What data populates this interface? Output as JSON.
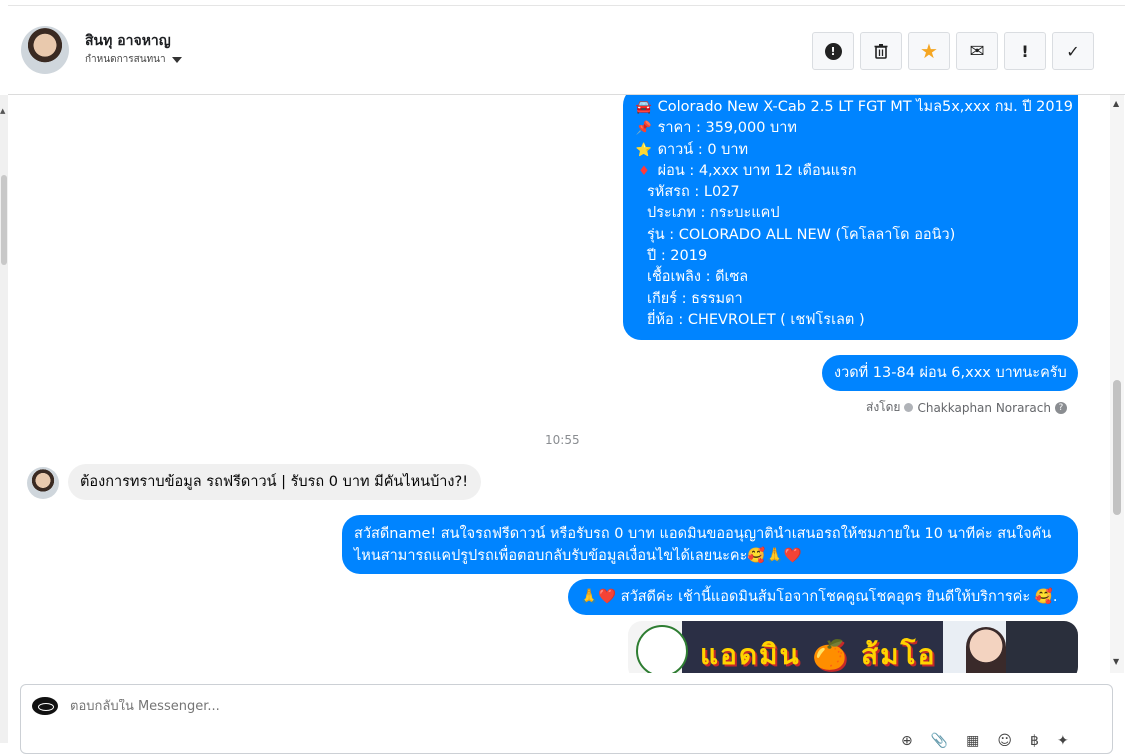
{
  "header": {
    "contact_name": "สินทุ อาจหาญ",
    "subtitle": "กำหนดการสนทนา",
    "actions": [
      {
        "name": "report",
        "glyph": "!"
      },
      {
        "name": "delete",
        "glyph": "🗑"
      },
      {
        "name": "star",
        "glyph": "★"
      },
      {
        "name": "mail",
        "glyph": "✉"
      },
      {
        "name": "important",
        "glyph": "!"
      },
      {
        "name": "done",
        "glyph": "✓"
      }
    ]
  },
  "messages": {
    "listing": {
      "line1": "Colorado New X-Cab 2.5 LT FGT MT ไมล5x,xxx กม. ปี 2019",
      "line2": "ราคา : 359,000 บาท",
      "line3": "ดาวน์ : 0 บาท",
      "line4": "ผ่อน : 4,xxx บาท 12 เดือนแรก",
      "line5": "รหัสรถ : L027",
      "line6": "ประเภท : กระบะแคป",
      "line7": "รุ่น : COLORADO ALL NEW (โคโลลาโด ออนิว)",
      "line8": "ปี : 2019",
      "line9": "เชื้อเพลิง : ดีเซล",
      "line10": "เกียร์ : ธรรมดา",
      "line11": "ยี่ห้อ : CHEVROLET ( เชฟโรเลต )",
      "emoji1": "🚘",
      "emoji2": "📌",
      "emoji3": "⭐",
      "emoji4": "♦"
    },
    "installment": "งวดที่ 13-84 ผ่อน 6,xxx บาทนะครับ",
    "sent_by_prefix": "ส่งโดย",
    "sent_by_name": "Chakkaphan Norarach",
    "time": "10:55",
    "incoming": "ต้องการทราบข้อมูล รถฟรีดาวน์ | รับรถ 0 บาท มีคันไหนบ้าง?!",
    "reply1": "สวัสดีname! สนใจรถฟรีดาวน์ หรือรับรถ 0 บาท แอดมินขออนุญาตินำเสนอรถให้ชมภายใน 10 นาทีค่ะ สนใจคันไหนสามารถแคปรูปรถเพื่อตอบกลับรับข้อมูลเงื่อนไขได้เลยนะคะ🥰🙏❤️",
    "reply2": "🙏❤️ สวัสดีค่ะ เช้านี้แอดมินส้มโอจากโชคคูณโชคอุดร ยินดีให้บริการค่ะ 🥰.",
    "banner_text": "แอดมิน 🍊 ส้มโอ"
  },
  "composer": {
    "placeholder": "ตอบกลับใน Messenger...",
    "tools": [
      "⊕",
      "📎",
      "▦",
      "☺",
      "฿",
      "✦"
    ]
  }
}
